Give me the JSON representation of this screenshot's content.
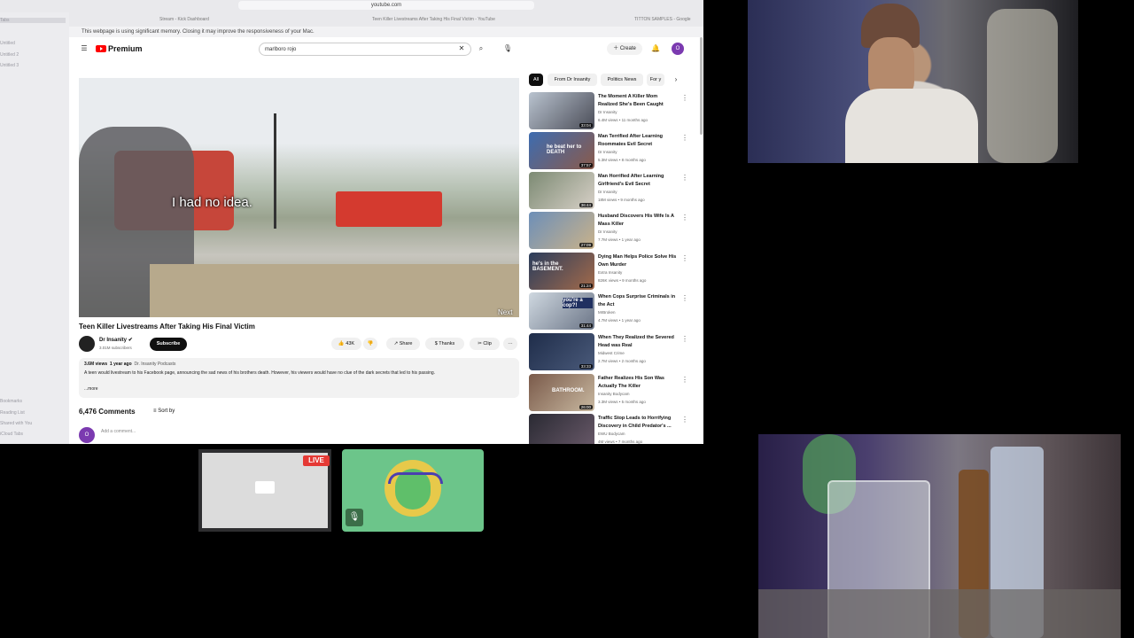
{
  "browser": {
    "url": "youtube.com",
    "tabs": [
      "Stream - Kick Dashboard",
      "Teen Killer Livestreams After Taking His Final Victim - YouTube",
      "TITTON SAMPLES - Google"
    ],
    "memory_warning": "This webpage is using significant memory. Closing it may improve the responsiveness of your Mac.",
    "sidebar_items": [
      "Tabs",
      "Untitled",
      "Untitled 2",
      "Untitled 3",
      "Bookmarks",
      "Reading List",
      "Shared with You",
      "iCloud Tabs"
    ]
  },
  "youtube": {
    "logo": "Premium",
    "search_value": "marlboro rojo",
    "create_label": "Create",
    "avatar_letter": "O",
    "video": {
      "caption": "I had no idea.",
      "corner_text": "Next",
      "title": "Teen Killer Livestreams After Taking His Final Victim",
      "channel": "Dr Insanity",
      "subscribers": "3.01M subscribers",
      "subscribe_label": "Subscribe",
      "likes": "43K",
      "share_label": "Share",
      "thanks_label": "Thanks",
      "clip_label": "Clip",
      "more_label": "···",
      "views": "3.6M views",
      "age": "1 year ago",
      "tag": "Dr. Insanity Podcasts",
      "description": "A teen would livestream to his Facebook page, announcing the sad news of his brothers death. However, his viewers would have no clue of the dark secrets that led to his passing.",
      "desc_more": "...more",
      "comments_count": "6,476 Comments",
      "sort_label": "Sort by",
      "add_comment_placeholder": "Add a comment..."
    },
    "chips": [
      "All",
      "From Dr Insanity",
      "Politics News",
      "For y"
    ],
    "recommendations": [
      {
        "title": "The Moment A Killer Mom Realized She's Been Caught",
        "channel": "Dr Insanity",
        "meta": "6.4M views • 11 months ago",
        "duration": "33:04",
        "thumb_text": ""
      },
      {
        "title": "Man Terrified After Learning Roommates Evil Secret",
        "channel": "Dr Insanity",
        "meta": "5.3M views • 8 months ago",
        "duration": "37:57",
        "thumb_text": "he beat her to DEATH"
      },
      {
        "title": "Man Horrified After Learning Girlfriend's Evil Secret",
        "channel": "Dr Insanity",
        "meta": "18M views • 9 months ago",
        "duration": "36:44",
        "thumb_text": ""
      },
      {
        "title": "Husband Discovers His Wife Is A Mass Killer",
        "channel": "Dr Insanity",
        "meta": "7.7M views • 1 year ago",
        "duration": "27:09",
        "thumb_text": ""
      },
      {
        "title": "Dying Man Helps Police Solve His Own Murder",
        "channel": "Extra Insanity",
        "meta": "826K views • 9 months ago",
        "duration": "21:24",
        "thumb_text": "he's in the BASEMENT."
      },
      {
        "title": "When Cops Surprise Criminals in the Act",
        "channel": "MrBroken",
        "meta": "4.7M views • 1 year ago",
        "duration": "31:44",
        "thumb_text": "you're a cop?!"
      },
      {
        "title": "When They Realized the Severed Head was Real",
        "channel": "Midwest Crime",
        "meta": "2.7M views • 2 months ago",
        "duration": "33:33",
        "thumb_text": ""
      },
      {
        "title": "Father Realizes His Son Was Actually The Killer",
        "channel": "Insanity Bodycam",
        "meta": "3.3M views • 5 months ago",
        "duration": "26:00",
        "thumb_text": "BATHROOM."
      },
      {
        "title": "Traffic Stop Leads to Horrifying Discovery in Child Predator's ...",
        "channel": "EWU Bodycam",
        "meta": "4M views • 7 months ago",
        "duration": "",
        "thumb_text": ""
      }
    ]
  },
  "stream": {
    "live_label": "LIVE"
  },
  "colors": {
    "youtube_red": "#ff0000",
    "live_red": "#e53935",
    "avatar_tile_green": "#6cc58a",
    "channel_avatar_purple": "#7b3ab0"
  }
}
